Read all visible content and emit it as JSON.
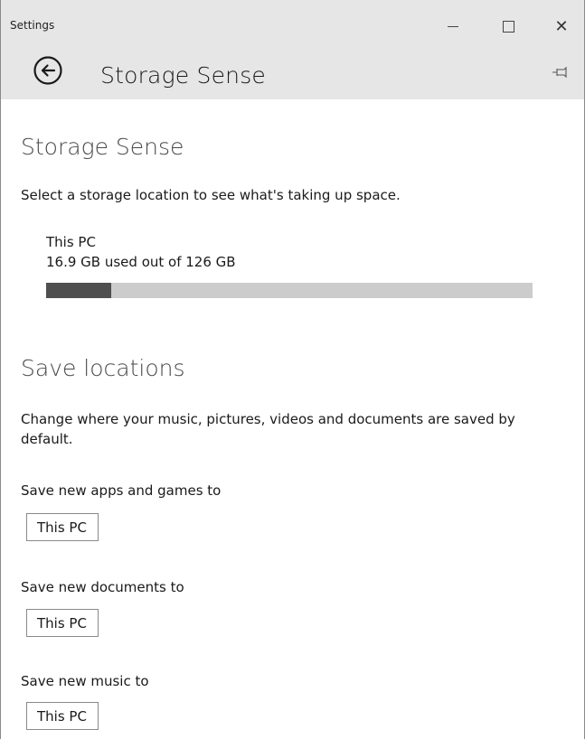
{
  "window": {
    "app_title": "Settings",
    "controls": {
      "minimize_icon": "minimize-icon",
      "maximize_icon": "maximize-icon",
      "close_icon": "close-icon",
      "close_glyph": "✕"
    }
  },
  "header": {
    "title": "Storage Sense",
    "back_icon": "back-arrow-icon",
    "pin_icon": "pin-icon"
  },
  "storage": {
    "section_title": "Storage Sense",
    "description": "Select a storage location to see what's taking up space.",
    "drive": {
      "name": "This PC",
      "usage_text": "16.9 GB used out of 126 GB",
      "used_gb": 16.9,
      "total_gb": 126
    }
  },
  "save_locations": {
    "section_title": "Save locations",
    "description": "Change where your music, pictures, videos and documents are saved by default.",
    "fields": [
      {
        "label": "Save new apps and games to",
        "value": "This PC"
      },
      {
        "label": "Save new documents to",
        "value": "This PC"
      },
      {
        "label": "Save new music to",
        "value": "This PC"
      }
    ]
  },
  "colors": {
    "chrome": "#e6e6e6",
    "usage_fill": "#4f4f4f",
    "usage_track": "#cccccc"
  }
}
